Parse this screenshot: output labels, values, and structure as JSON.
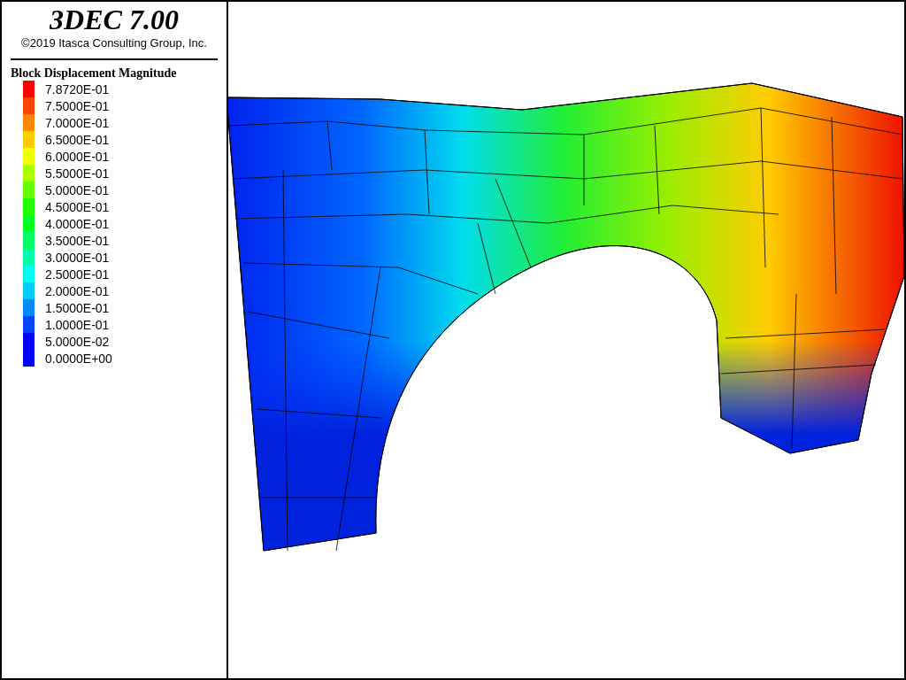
{
  "header": {
    "title": "3DEC 7.00",
    "copyright": "©2019 Itasca Consulting Group, Inc."
  },
  "legend": {
    "title": "Block Displacement Magnitude",
    "items": [
      {
        "label": "7.8720E-01",
        "color": "#ff0000"
      },
      {
        "label": "7.5000E-01",
        "color": "#ff4400"
      },
      {
        "label": "7.0000E-01",
        "color": "#ff8800"
      },
      {
        "label": "6.5000E-01",
        "color": "#ffcc00"
      },
      {
        "label": "6.0000E-01",
        "color": "#eeff00"
      },
      {
        "label": "5.5000E-01",
        "color": "#aaff00"
      },
      {
        "label": "5.0000E-01",
        "color": "#66ff00"
      },
      {
        "label": "4.5000E-01",
        "color": "#22ff00"
      },
      {
        "label": "4.0000E-01",
        "color": "#00ff22"
      },
      {
        "label": "3.5000E-01",
        "color": "#00ff66"
      },
      {
        "label": "3.0000E-01",
        "color": "#00ffaa"
      },
      {
        "label": "2.5000E-01",
        "color": "#00ffee"
      },
      {
        "label": "2.0000E-01",
        "color": "#00ccff"
      },
      {
        "label": "1.5000E-01",
        "color": "#0088ff"
      },
      {
        "label": "1.0000E-01",
        "color": "#0044ff"
      },
      {
        "label": "5.0000E-02",
        "color": "#0000ff"
      },
      {
        "label": "0.0000E+00",
        "color": "#0000fe"
      }
    ]
  }
}
